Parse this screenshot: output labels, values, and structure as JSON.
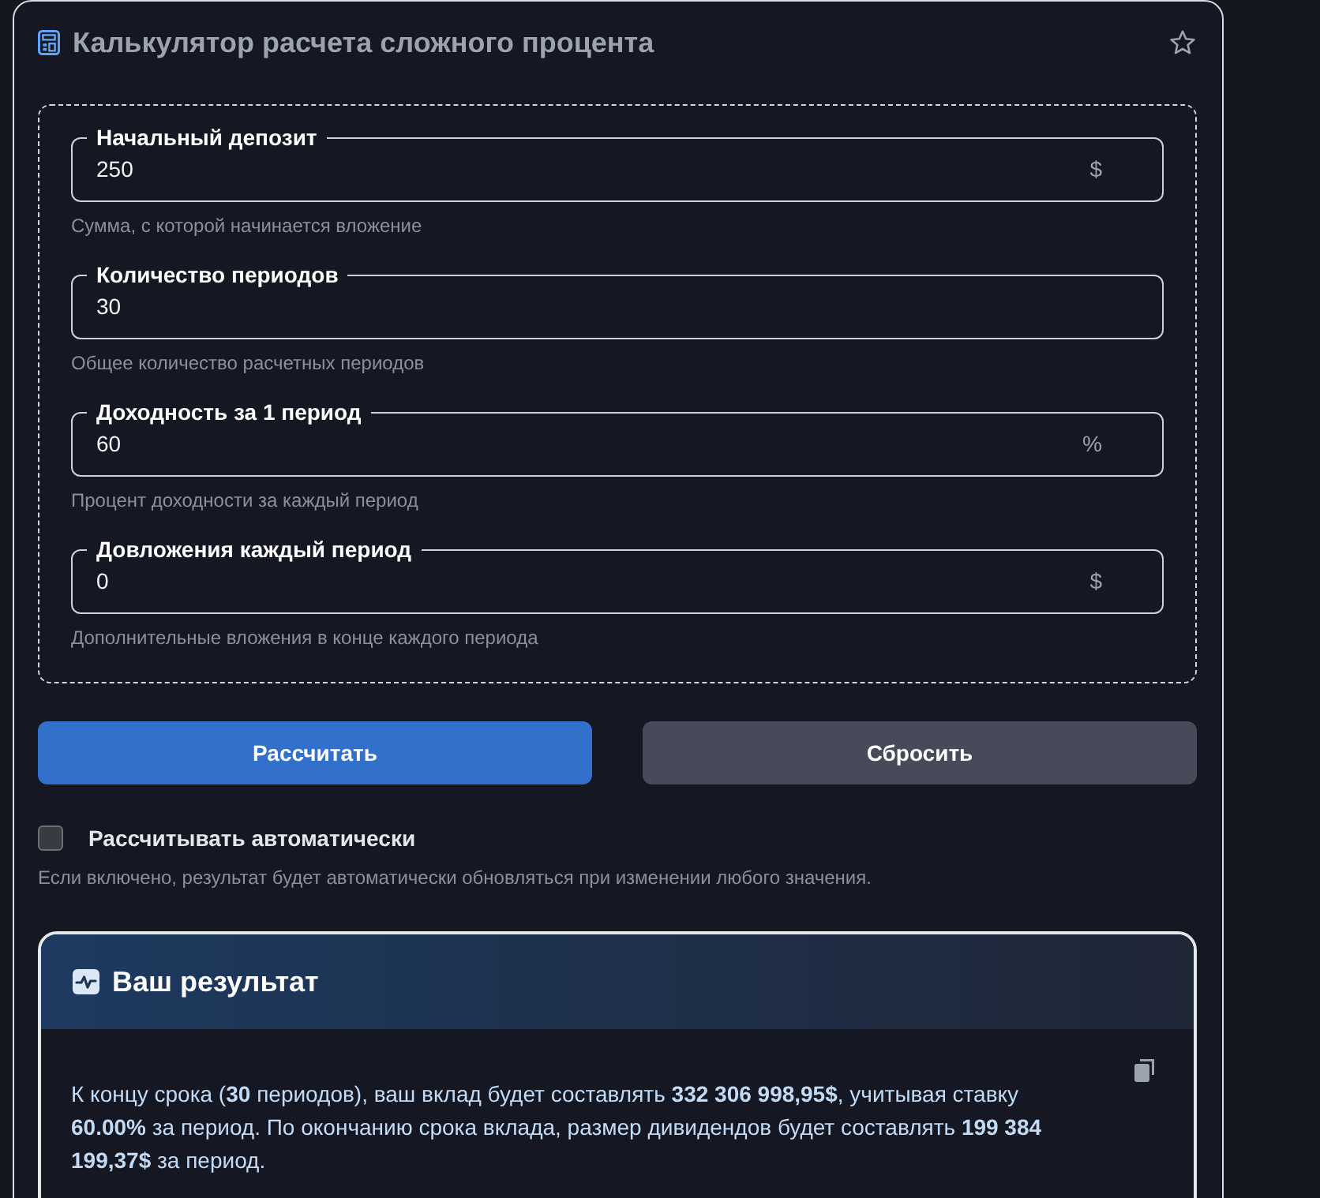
{
  "header": {
    "title": "Калькулятор расчета сложного процента"
  },
  "fields": [
    {
      "label": "Начальный депозит",
      "value": "250",
      "unit": "$",
      "hint": "Сумма, с которой начинается вложение"
    },
    {
      "label": "Количество периодов",
      "value": "30",
      "hint": "Общее количество расчетных периодов"
    },
    {
      "label": "Доходность за 1 период",
      "value": "60",
      "unit": "%",
      "hint": "Процент доходности за каждый период"
    },
    {
      "label": "Довложения каждый период",
      "value": "0",
      "unit": "$",
      "hint": "Дополнительные вложения в конце каждого периода"
    }
  ],
  "buttons": [
    {
      "label": "Рассчитать",
      "kind": "primary"
    },
    {
      "label": "Сбросить",
      "kind": "secondary"
    }
  ],
  "auto_calculate": {
    "label": "Рассчитывать автоматически",
    "checked": false,
    "hint": "Если включено, результат будет автоматически обновляться при изменении любого значения."
  },
  "result": {
    "title": "Ваш результат",
    "text": "К концу срока (**30** периодов), ваш вклад будет составлять **332 306 998,95$**, учитывая ставку **60.00%** за период. По окончанию срока вклада, размер дивидендов будет составлять **199 384 199,37$** за период."
  }
}
